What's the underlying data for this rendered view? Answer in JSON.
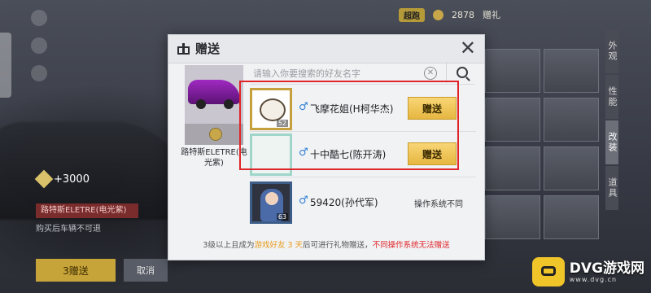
{
  "background": {
    "toolbar_badge": "超跑",
    "toolbar_count": "2878",
    "toolbar_tab": "赠礼",
    "reward_amount": "+3000",
    "car_title": "路特斯ELETRE(电光紫)",
    "info_text": "购买后车辆不可退",
    "gold_button_label": "3赠送",
    "gray_button_label": "取消",
    "side_tabs": [
      "外观",
      "性能",
      "改装",
      "道具"
    ]
  },
  "dialog": {
    "title": "赠送",
    "title_icon": "gift-icon",
    "close_icon": "close-icon",
    "car": {
      "name": "路特斯ELETRE(电光紫)",
      "color": "#8e24aa"
    },
    "search": {
      "placeholder": "请输入你要搜索的好友名字",
      "value": ""
    },
    "friends": [
      {
        "name": "飞摩花姐(H柯华杰)",
        "gender": "male",
        "level": "52",
        "action": "赠送",
        "frame": "gold"
      },
      {
        "name": "十中酷七(陈开涛)",
        "gender": "male",
        "level": "",
        "action": "赠送",
        "frame": "silver"
      },
      {
        "name": "59420(孙代军)",
        "gender": "male",
        "level": "63",
        "status": "操作系统不同",
        "frame": "dark"
      }
    ],
    "footer": {
      "part1": "3级以上且成为",
      "part2": "游戏好友 3 天",
      "part3": "后可进行礼物赠送，",
      "part4": "不同操作系统无法赠送"
    }
  },
  "colors": {
    "gift_button": "#f0c552",
    "highlight": "#e0252a",
    "male_icon": "#2d7fd4"
  },
  "watermark": {
    "text": "DVG游戏网",
    "url": "www.dvg.cn"
  }
}
